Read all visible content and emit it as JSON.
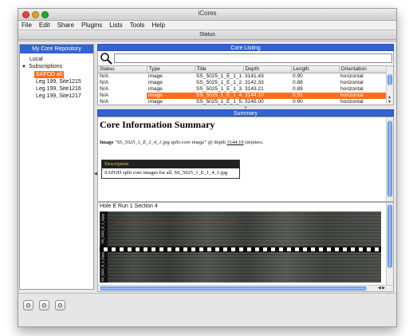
{
  "window": {
    "title": "iCores"
  },
  "menu": [
    "File",
    "Edit",
    "Share",
    "Plugins",
    "Lists",
    "Tools",
    "Help"
  ],
  "status_bar": {
    "label": "Status"
  },
  "sidebar": {
    "header": "My Core Repository",
    "items": [
      {
        "label": "Local",
        "level": 1
      },
      {
        "label": "Subscriptions",
        "level": 1,
        "expanded": true
      },
      {
        "label": "SAFOD all",
        "level": 2,
        "selected": true
      },
      {
        "label": "Leg 199, Site1215",
        "level": 2
      },
      {
        "label": "Leg 199, Site1216",
        "level": 2
      },
      {
        "label": "Leg 199, Site1217",
        "level": 2
      }
    ]
  },
  "core_listing": {
    "header": "Core Listing",
    "search_placeholder": "",
    "columns": [
      "Status",
      "Type",
      "Title",
      "Depth",
      "Length",
      "Orientation"
    ],
    "rows": [
      {
        "status": "N/A",
        "type": "image",
        "title": "SS_5025_1_E_1_1...",
        "depth": "3141.43",
        "length": "0.90",
        "orientation": "horizontal"
      },
      {
        "status": "N/A",
        "type": "image",
        "title": "SS_5025_1_E_1_2...",
        "depth": "3142.33",
        "length": "0.88",
        "orientation": "horizontal"
      },
      {
        "status": "N/A",
        "type": "image",
        "title": "SS_5025_1_E_1_3...",
        "depth": "3143.21",
        "length": "0.89",
        "orientation": "horizontal"
      },
      {
        "status": "N/A",
        "type": "image",
        "title": "SS_5025_1_E_1_4...",
        "depth": "3144.10",
        "length": "0.91",
        "orientation": "horizontal",
        "selected": true
      },
      {
        "status": "N/A",
        "type": "image",
        "title": "SS_5025_1_E_1_5...",
        "depth": "3145.00",
        "length": "0.90",
        "orientation": "horizontal"
      }
    ]
  },
  "summary": {
    "header": "Summary",
    "title": "Core Information Summary",
    "image_label": "Image",
    "image_name": "\"SS_5025_1_E_1_4_1.jpg split-core image\"",
    "at_depth": "@ depth",
    "depth_value": "3144.10",
    "depth_unit": "(m)eters.",
    "description_head": "Description",
    "description_text": "SAFOD split core images for all. SS_5025_1_E_1_4_1.jpg"
  },
  "images": {
    "section_label": "Hole E Run 1 Section 4",
    "tag1": "SS_5025_E_1_4.jpg",
    "tag2": "SS_5025_E_1_5.jpg"
  },
  "colors": {
    "accent_blue": "#3263d3",
    "selection_orange": "#ff6d19"
  }
}
